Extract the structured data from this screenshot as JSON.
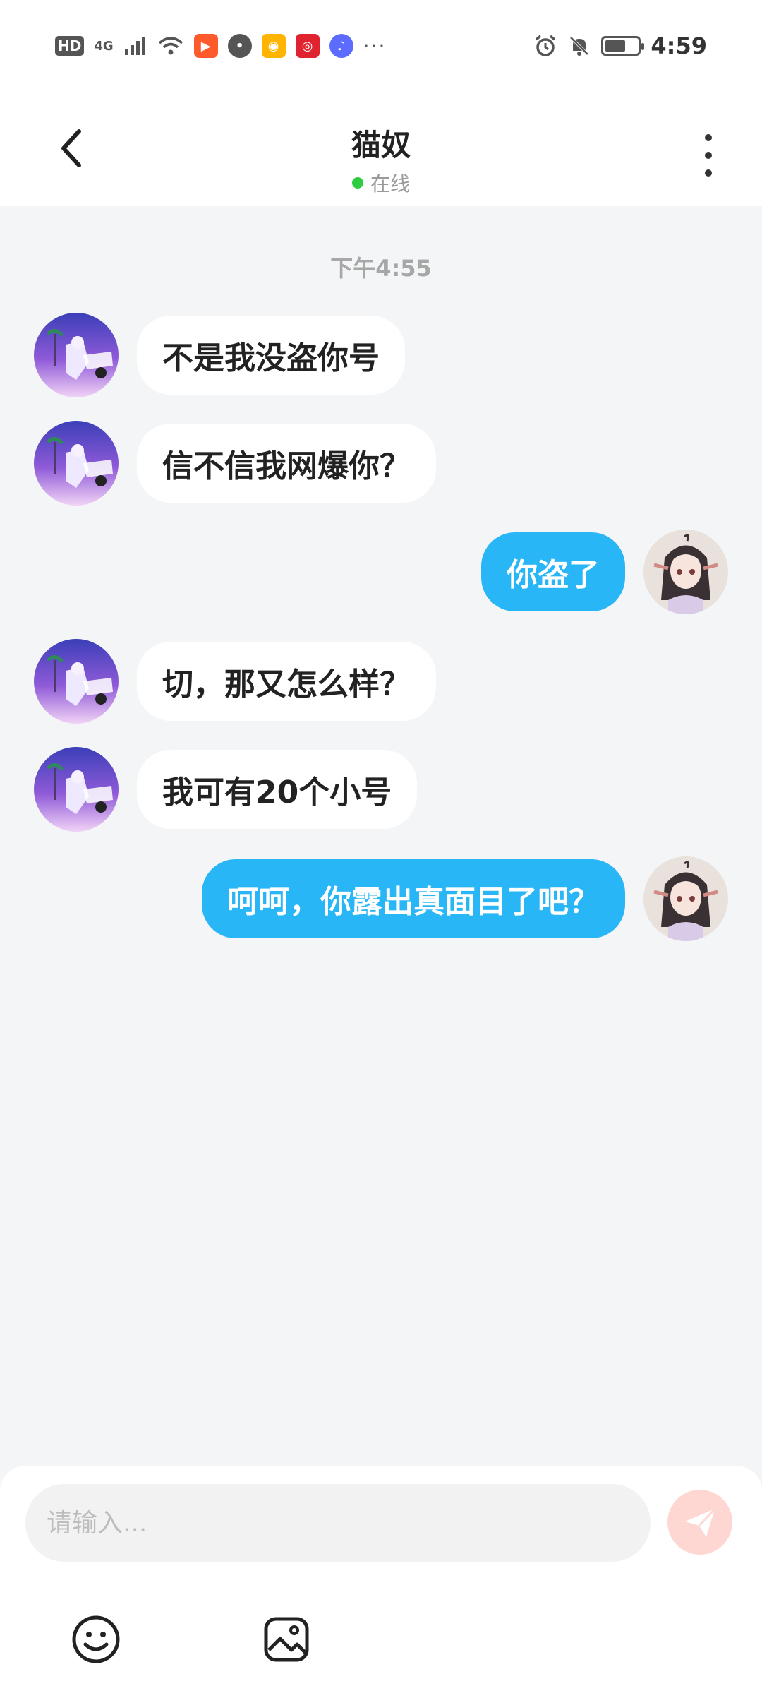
{
  "status_bar": {
    "left_badge": "HD",
    "network": "4G",
    "time": "4:59",
    "more": "···",
    "app_icons": [
      {
        "name": "kuaishou-icon",
        "color": "#ff5a2c"
      },
      {
        "name": "message-icon",
        "color": "#555555"
      },
      {
        "name": "weibo-icon",
        "color": "#ffb400"
      },
      {
        "name": "netease-music-icon",
        "color": "#e0242f"
      },
      {
        "name": "music-icon",
        "color": "#5b6cff"
      }
    ]
  },
  "header": {
    "title": "猫奴",
    "status": "在线"
  },
  "conversation": {
    "time_divider": "下午4:55",
    "messages": [
      {
        "side": "left",
        "text": "不是我没盗你号"
      },
      {
        "side": "left",
        "text": "信不信我网爆你？"
      },
      {
        "side": "right",
        "text": "你盗了"
      },
      {
        "side": "left",
        "text": "切，那又怎么样？"
      },
      {
        "side": "left",
        "text": "我可有20个小号"
      },
      {
        "side": "right",
        "text": "呵呵，你露出真面目了吧？"
      }
    ]
  },
  "composer": {
    "placeholder": "请输入..."
  },
  "colors": {
    "outgoing_bubble": "#29b6f6",
    "incoming_bubble": "#ffffff",
    "background": "#f4f5f7",
    "online_dot": "#2ecc40",
    "send_button": "#ffd7d2"
  }
}
